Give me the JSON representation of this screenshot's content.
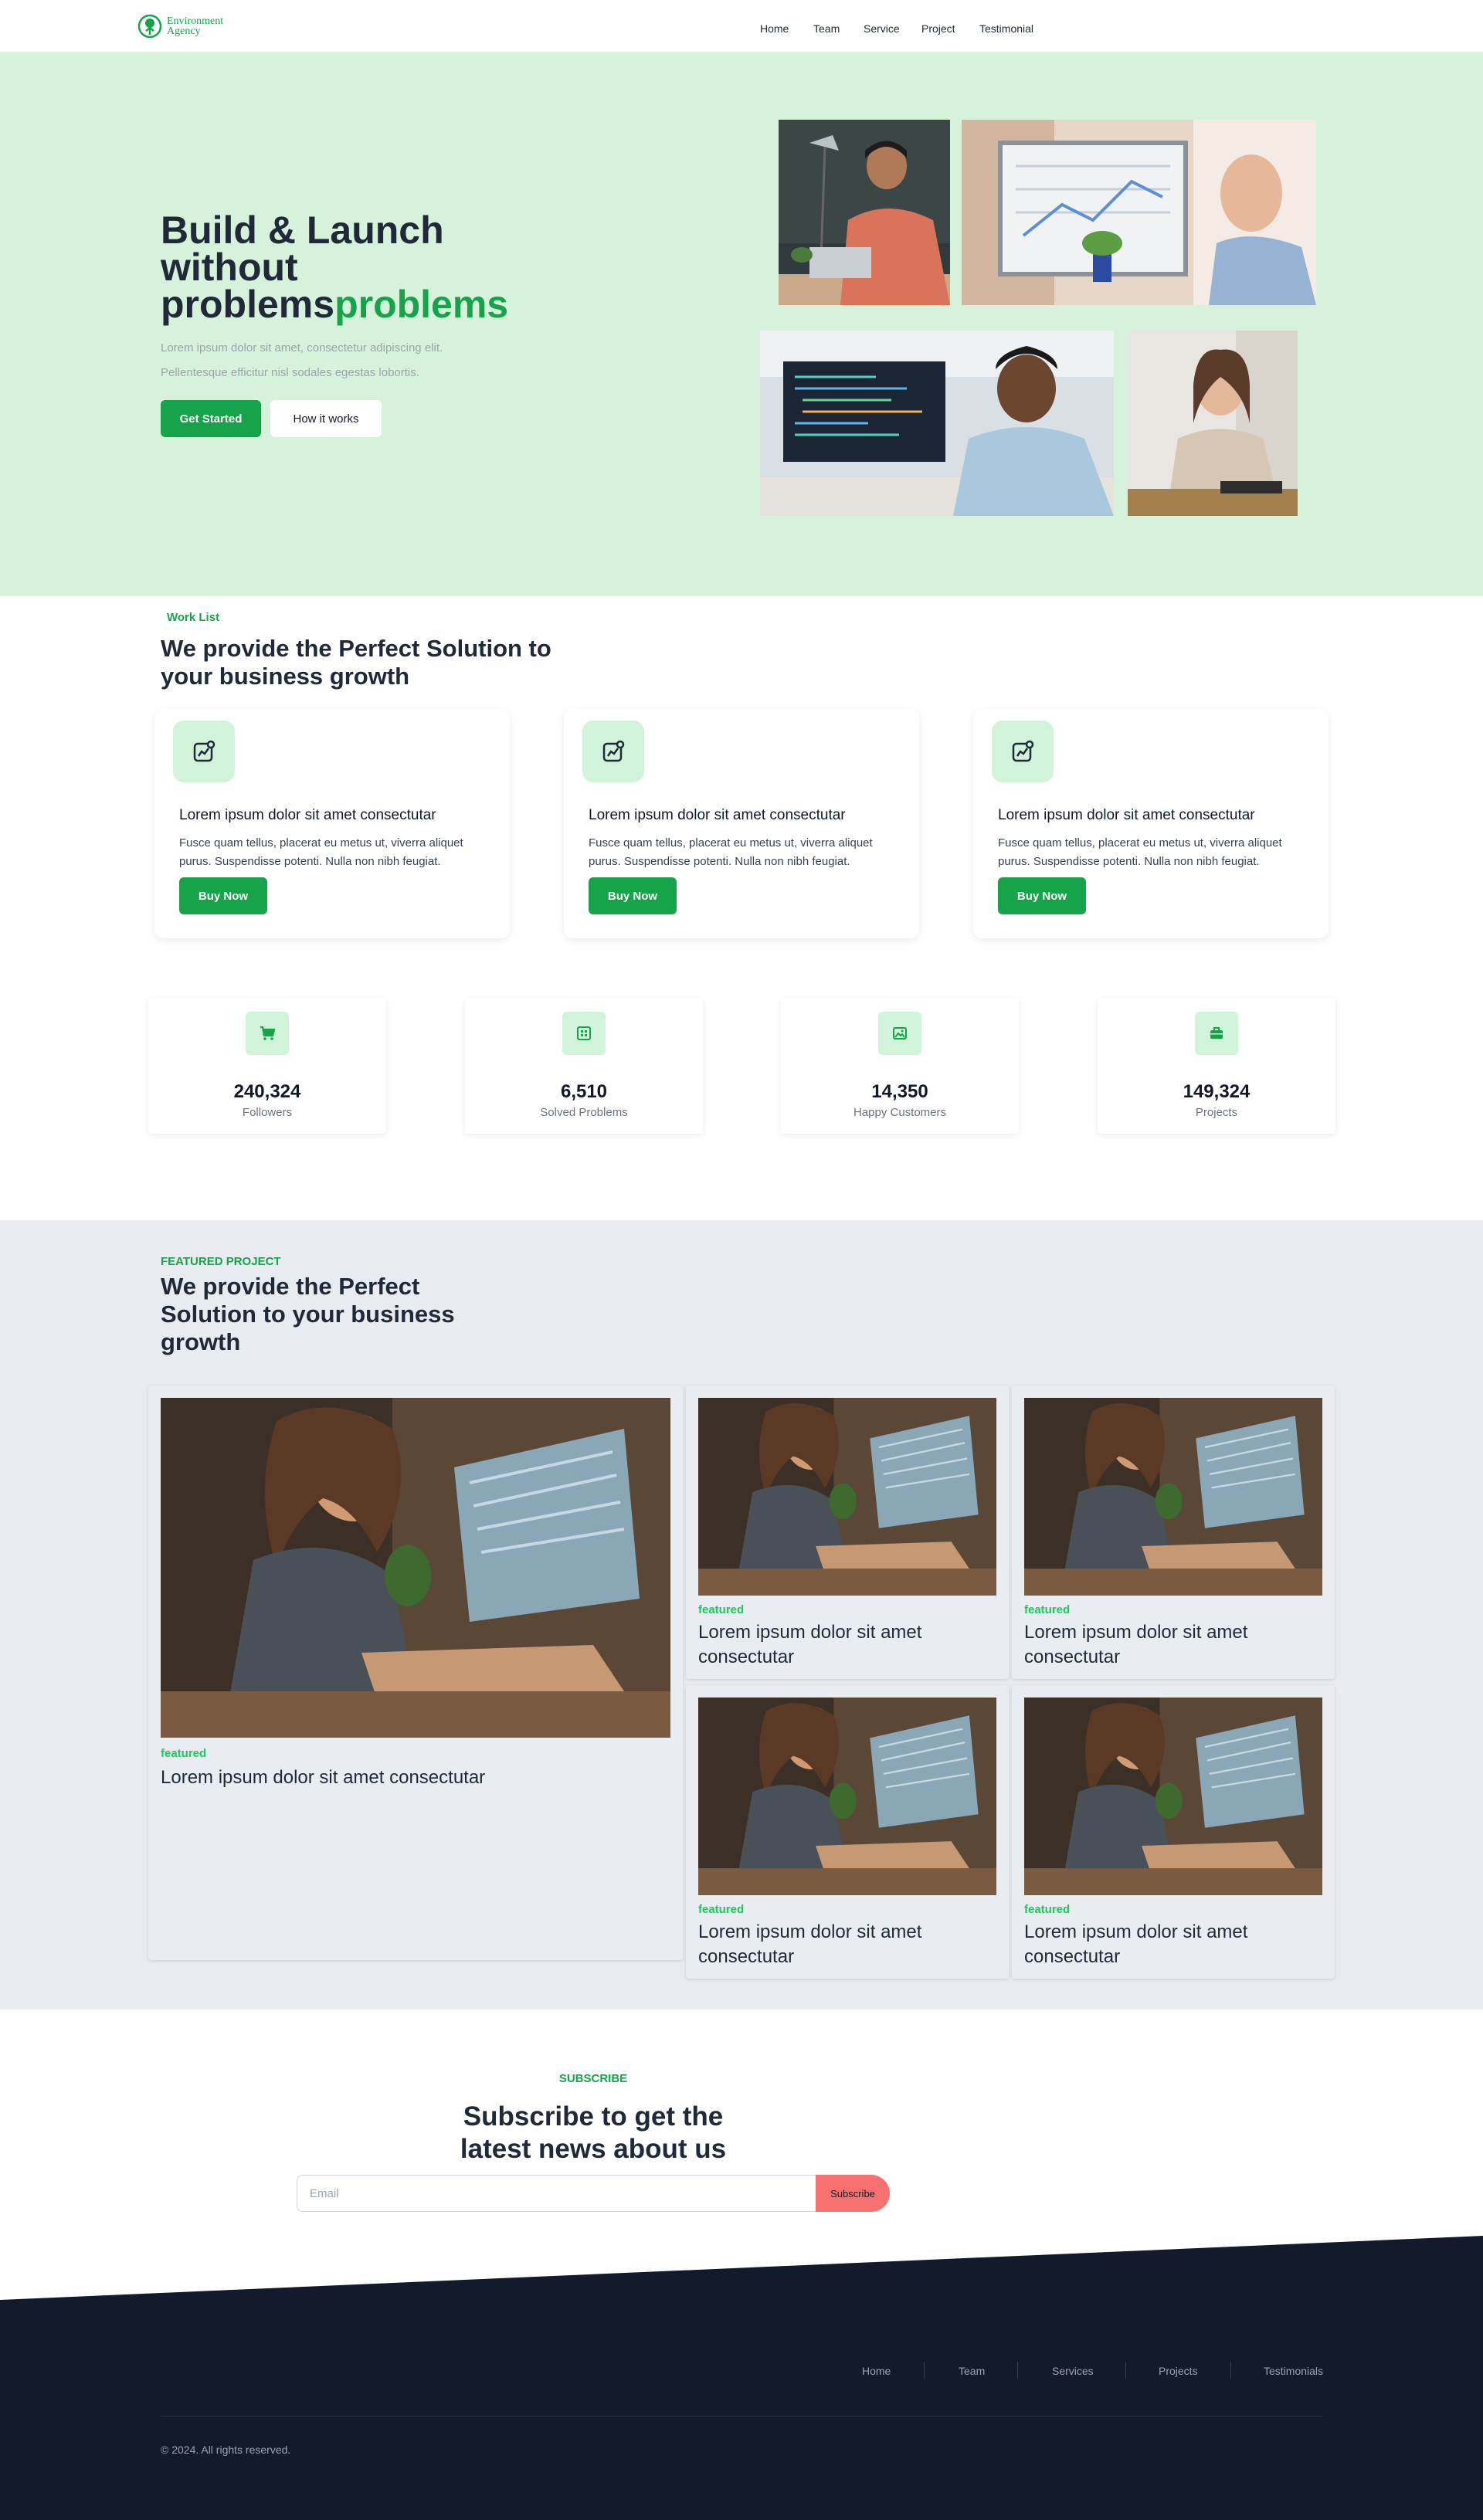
{
  "brand": {
    "logo_line1": "Environment",
    "logo_line2": "Agency",
    "green": "#16a34a",
    "hero_bg": "#d7f2da",
    "dark": "#111827",
    "coral": "#f87171"
  },
  "nav": {
    "items": [
      "Home",
      "Team",
      "Service",
      "Project",
      "Testimonial"
    ]
  },
  "hero": {
    "title_line1": "Build & Launch",
    "title_line2": "without",
    "title_dark_word": "problems",
    "title_green_word": "problems",
    "description": "Lorem ipsum dolor sit amet, consectetur adipiscing elit. Pellentesque efficitur nisl sodales egestas lobortis.",
    "primary_button": "Get Started",
    "secondary_button": "How it works"
  },
  "work": {
    "eyebrow": "Work List",
    "title": "We provide the Perfect Solution to your business growth",
    "cards": [
      {
        "icon": "chart-sparkle-icon",
        "title": "Lorem ipsum dolor sit amet consectutar",
        "text": "Fusce quam tellus, placerat eu metus ut, viverra aliquet purus. Suspendisse potenti. Nulla non nibh feugiat.",
        "button": "Buy Now"
      },
      {
        "icon": "chart-sparkle-icon",
        "title": "Lorem ipsum dolor sit amet consectutar",
        "text": "Fusce quam tellus, placerat eu metus ut, viverra aliquet purus. Suspendisse potenti. Nulla non nibh feugiat.",
        "button": "Buy Now"
      },
      {
        "icon": "chart-sparkle-icon",
        "title": "Lorem ipsum dolor sit amet consectutar",
        "text": "Fusce quam tellus, placerat eu metus ut, viverra aliquet purus. Suspendisse potenti. Nulla non nibh feugiat.",
        "button": "Buy Now"
      }
    ]
  },
  "stats": [
    {
      "icon": "cart-icon",
      "value": "240,324",
      "label": "Followers"
    },
    {
      "icon": "grid-icon",
      "value": "6,510",
      "label": "Solved Problems"
    },
    {
      "icon": "image-icon",
      "value": "14,350",
      "label": "Happy Customers"
    },
    {
      "icon": "briefcase-icon",
      "value": "149,324",
      "label": "Projects"
    }
  ],
  "featured": {
    "eyebrow": "FEATURED PROJECT",
    "title": "We provide the Perfect Solution to your business growth",
    "main": {
      "tag": "featured",
      "title": "Lorem ipsum dolor sit amet consectutar"
    },
    "items": [
      {
        "tag": "featured",
        "title": "Lorem ipsum dolor sit amet consectutar"
      },
      {
        "tag": "featured",
        "title": "Lorem ipsum dolor sit amet consectutar"
      },
      {
        "tag": "featured",
        "title": "Lorem ipsum dolor sit amet consectutar"
      },
      {
        "tag": "featured",
        "title": "Lorem ipsum dolor sit amet consectutar"
      }
    ]
  },
  "subscribe": {
    "eyebrow": "SUBSCRIBE",
    "title": "Subscribe to get the latest news about us",
    "placeholder": "Email",
    "button": "Subscribe"
  },
  "footer": {
    "links": [
      "Home",
      "Team",
      "Services",
      "Projects",
      "Testimonials"
    ],
    "copyright": "© 2024. All rights reserved."
  }
}
